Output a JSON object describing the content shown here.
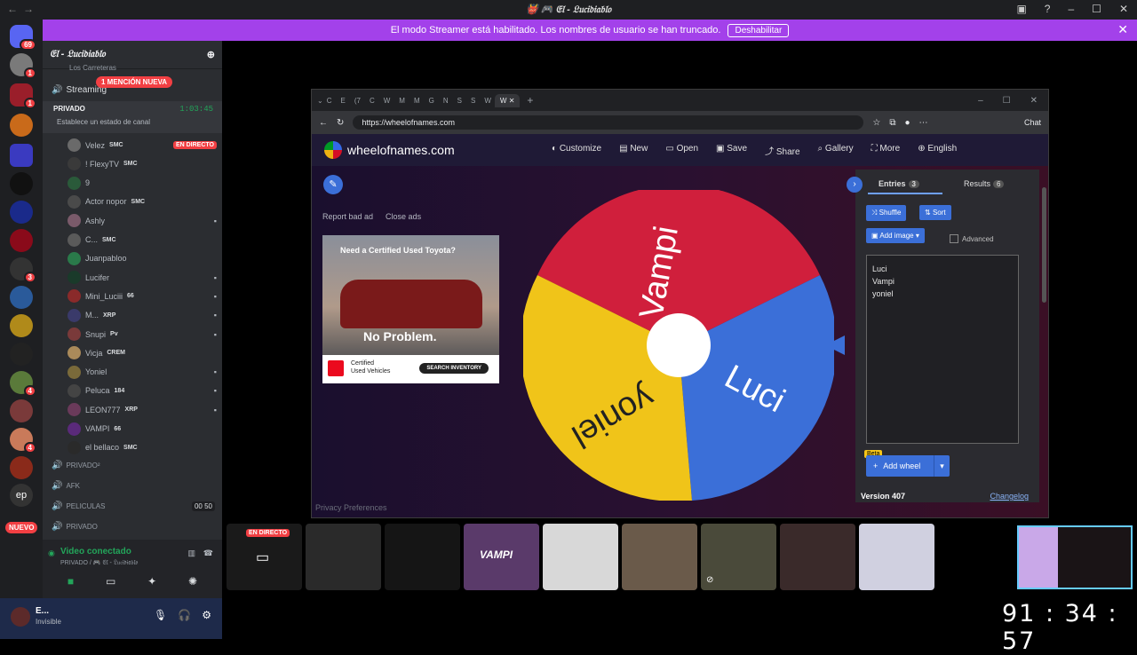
{
  "window": {
    "title": "👹 🎮 𝔈𝔩 - 𝔏𝔲𝔠𝔦𝔡𝔦𝔞𝔟𝔩𝔬"
  },
  "streamer_banner": {
    "text": "El modo Streamer está habilitado. Los nombres de usuario se han truncado.",
    "button": "Deshabilitar"
  },
  "servers": {
    "home_badge": "69",
    "badges": [
      "1",
      "1",
      "3",
      "4",
      "4"
    ],
    "ep_label": "ep",
    "nuevo": "NUEVO"
  },
  "channel_list": {
    "server_name": "𝔈𝔩 - 𝔏𝔲𝔠𝔦𝔡𝔦𝔞𝔟𝔩𝔬",
    "top_channel": "Los Carreteras",
    "streaming_channel": "Streaming",
    "mention_badge": "1 MENCIÓN NUEVA",
    "private_channel": {
      "name": "PRIVADO",
      "status": "Establece un estado de canal",
      "timer": "1:03:45"
    },
    "users": [
      {
        "name": "Velez",
        "tag": "SMC",
        "live": "EN DIRECTO"
      },
      {
        "name": "! FlexyTV",
        "tag": "SMC"
      },
      {
        "name": "9",
        "tag": ""
      },
      {
        "name": "Actor nopor",
        "tag": "SMC"
      },
      {
        "name": "Ashly",
        "tag": ""
      },
      {
        "name": "C...",
        "tag": "SMC"
      },
      {
        "name": "Juanpabloo",
        "tag": ""
      },
      {
        "name": "Lucifer",
        "tag": ""
      },
      {
        "name": "Mini_Luciii",
        "tag": "66"
      },
      {
        "name": "M...",
        "tag": "XRP"
      },
      {
        "name": "Snupi",
        "tag": "Pv"
      },
      {
        "name": "Vicja",
        "tag": "CREM"
      },
      {
        "name": "Yoniel",
        "tag": ""
      },
      {
        "name": "Peluca",
        "tag": "184"
      },
      {
        "name": "LEON777",
        "tag": "XRP"
      },
      {
        "name": "VAMPI",
        "tag": "66"
      },
      {
        "name": "el bellaco",
        "tag": "SMC"
      }
    ],
    "channels_below": [
      {
        "name": "PRIVADO²",
        "count": ""
      },
      {
        "name": "AFK",
        "count": ""
      },
      {
        "name": "PELICULAS",
        "count": "00 50"
      },
      {
        "name": "PRIVADO",
        "count": ""
      }
    ]
  },
  "voice_panel": {
    "status": "Video conectado",
    "location": "PRIVADO / 🎮 𝔈𝔩 - 𝔏𝔲𝔠𝔦𝔡𝔦𝔞𝔟𝔩𝔬"
  },
  "user_panel": {
    "name": "E...",
    "status": "Invisible"
  },
  "browser": {
    "tabs": [
      "C",
      "E",
      "(7",
      "C",
      "W",
      "M",
      "M",
      "G",
      "N",
      "S",
      "S",
      "W"
    ],
    "active_tab": "W",
    "url": "https://wheelofnames.com",
    "chat_label": "Chat"
  },
  "site": {
    "logo": "wheelofnames.com",
    "menu": [
      "Customize",
      "New",
      "Open",
      "Save",
      "Share",
      "Gallery",
      "More",
      "English"
    ],
    "report_ad": "Report bad ad",
    "close_ads": "Close ads",
    "ad": {
      "headline": "Need a Certified Used Toyota?",
      "tagline": "No Problem.",
      "brand_line1": "Certified",
      "brand_line2": "Used Vehicles",
      "cta": "SEARCH INVENTORY"
    },
    "wheel_names": [
      "Vampi",
      "Luci",
      "yoniel"
    ],
    "panel": {
      "entries_tab": "Entries",
      "entries_count": "3",
      "results_tab": "Results",
      "results_count": "6",
      "shuffle": "Shuffle",
      "sort": "Sort",
      "add_image": "Add image",
      "advanced": "Advanced",
      "entries": [
        "Luci",
        "Vampi",
        "yoniel"
      ],
      "beta": "Beta",
      "add_wheel": "Add wheel",
      "version": "Version 407",
      "changelog": "Changelog"
    },
    "privacy": "Privacy Preferences",
    "colors": {
      "red": "#d01f3c",
      "blue": "#3b6fd8",
      "yellow": "#f0c419"
    }
  },
  "tiles": {
    "live_label": "EN DIRECTO",
    "vampi_label": "VAMPI"
  },
  "timer": "91 : 34 : 57"
}
